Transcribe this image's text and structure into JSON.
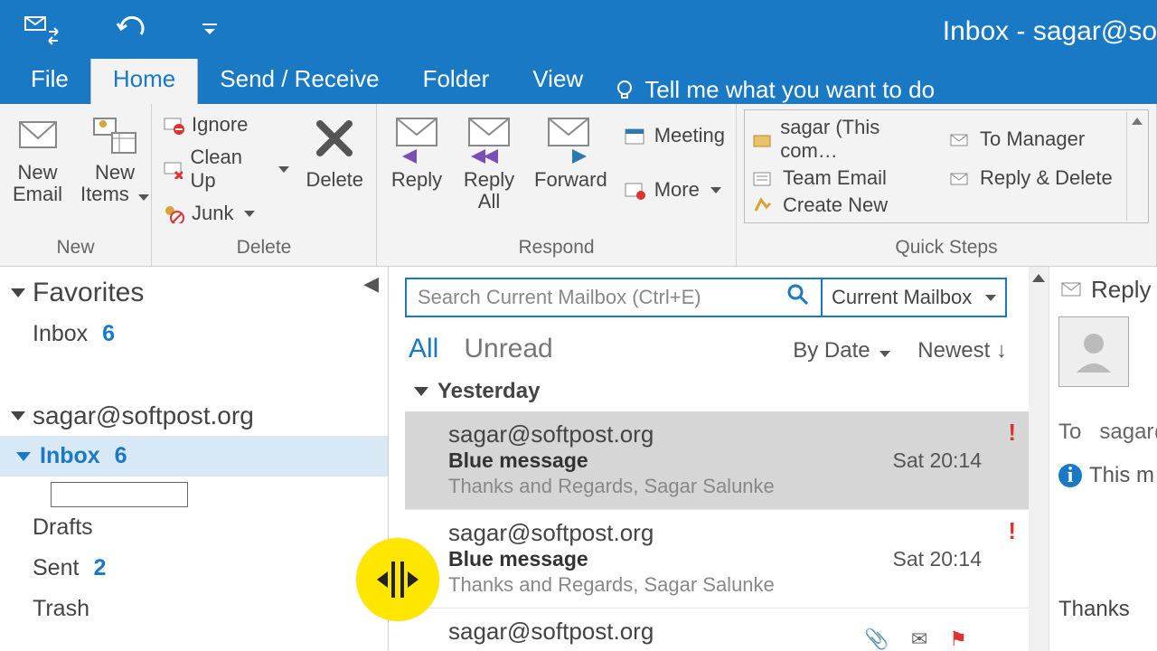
{
  "window_title": "Inbox - sagar@so",
  "tabs": {
    "file": "File",
    "home": "Home",
    "sendrec": "Send / Receive",
    "folder": "Folder",
    "view": "View"
  },
  "tellme": "Tell me what you want to do",
  "ribbon": {
    "new": {
      "new_email": "New\nEmail",
      "new_items": "New\nItems",
      "group": "New"
    },
    "delete": {
      "ignore": "Ignore",
      "cleanup": "Clean Up",
      "junk": "Junk",
      "delete": "Delete",
      "group": "Delete"
    },
    "respond": {
      "reply": "Reply",
      "replyall": "Reply\nAll",
      "forward": "Forward",
      "meeting": "Meeting",
      "more": "More",
      "group": "Respond"
    },
    "quicksteps": {
      "items": [
        "sagar (This com…",
        "To Manager",
        "Team Email",
        "Reply & Delete",
        "Create New"
      ],
      "group": "Quick Steps"
    }
  },
  "nav": {
    "favorites": "Favorites",
    "fav_items": [
      {
        "label": "Inbox",
        "count": "6"
      }
    ],
    "account": "sagar@softpost.org",
    "folders": [
      {
        "label": "Inbox",
        "count": "6",
        "sel": true
      },
      {
        "label": "Drafts"
      },
      {
        "label": "Sent",
        "count": "2"
      },
      {
        "label": "Trash"
      }
    ],
    "rename_value": ""
  },
  "search": {
    "placeholder": "Search Current Mailbox (Ctrl+E)",
    "scope": "Current Mailbox"
  },
  "filters": {
    "all": "All",
    "unread": "Unread",
    "sort": "By Date",
    "order": "Newest"
  },
  "grouphdr": "Yesterday",
  "messages": [
    {
      "from": "sagar@softpost.org",
      "subject": "Blue message",
      "time": "Sat 20:14",
      "preview": "Thanks and Regards,  Sagar Salunke",
      "priority": true,
      "sel": true
    },
    {
      "from": "sagar@softpost.org",
      "subject": "Blue message",
      "time": "Sat 20:14",
      "preview": "Thanks and Regards,  Sagar Salunke",
      "priority": true
    },
    {
      "from": "sagar@softpost.org"
    }
  ],
  "reading": {
    "reply": "Reply",
    "to_label": "To",
    "to_value": "sagar@",
    "info": "This m",
    "thanks": "Thanks"
  }
}
